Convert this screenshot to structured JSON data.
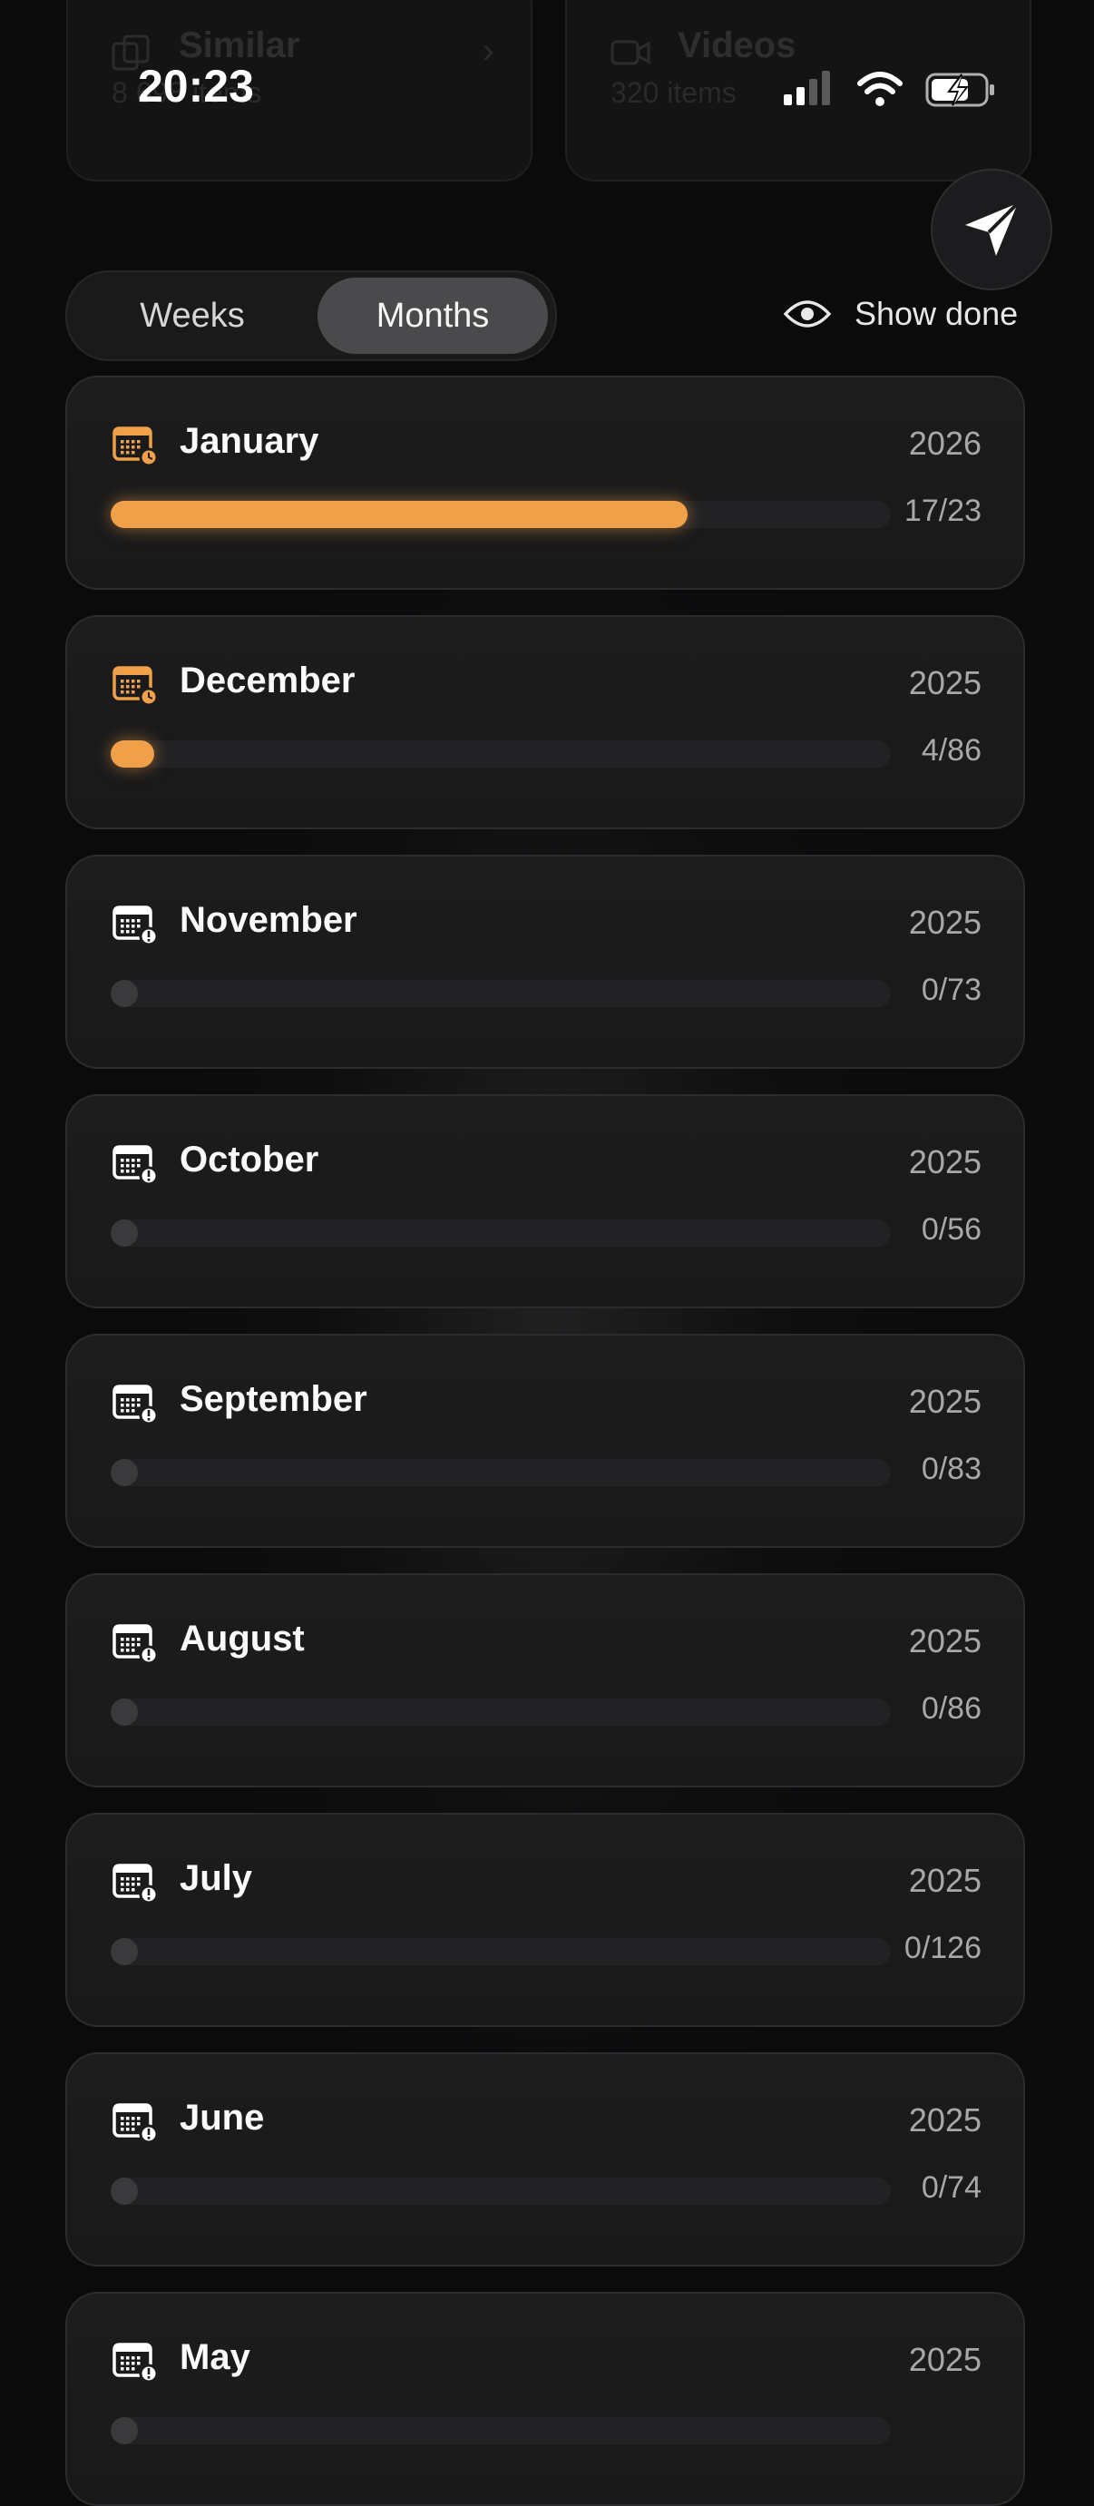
{
  "status_bar": {
    "time": "20:23"
  },
  "top_cards": [
    {
      "title": "Similar",
      "subtitle": "8 698 items",
      "icon": "similar-icon"
    },
    {
      "title": "Videos",
      "subtitle": "320 items",
      "icon": "video-camera-icon"
    }
  ],
  "segmented": {
    "weeks_label": "Weeks",
    "months_label": "Months",
    "selected": "Months"
  },
  "show_done": {
    "label": "Show done",
    "icon": "eye-icon"
  },
  "months": [
    {
      "name": "January",
      "year": "2026",
      "count": "17/23",
      "done": 17,
      "total": 23,
      "icon": "calendar-clock-icon",
      "accent": "#f0a048"
    },
    {
      "name": "December",
      "year": "2025",
      "count": "4/86",
      "done": 4,
      "total": 86,
      "icon": "calendar-clock-icon",
      "accent": "#f0a048"
    },
    {
      "name": "November",
      "year": "2025",
      "count": "0/73",
      "done": 0,
      "total": 73,
      "icon": "calendar-alert-icon",
      "accent": "#ffffff"
    },
    {
      "name": "October",
      "year": "2025",
      "count": "0/56",
      "done": 0,
      "total": 56,
      "icon": "calendar-alert-icon",
      "accent": "#ffffff"
    },
    {
      "name": "September",
      "year": "2025",
      "count": "0/83",
      "done": 0,
      "total": 83,
      "icon": "calendar-alert-icon",
      "accent": "#ffffff"
    },
    {
      "name": "August",
      "year": "2025",
      "count": "0/86",
      "done": 0,
      "total": 86,
      "icon": "calendar-alert-icon",
      "accent": "#ffffff"
    },
    {
      "name": "July",
      "year": "2025",
      "count": "0/126",
      "done": 0,
      "total": 126,
      "icon": "calendar-alert-icon",
      "accent": "#ffffff"
    },
    {
      "name": "June",
      "year": "2025",
      "count": "0/74",
      "done": 0,
      "total": 74,
      "icon": "calendar-alert-icon",
      "accent": "#ffffff"
    },
    {
      "name": "May",
      "year": "2025",
      "count": "",
      "done": 0,
      "total": 0,
      "icon": "calendar-alert-icon",
      "accent": "#ffffff"
    }
  ],
  "colors": {
    "accent": "#f0a048",
    "background": "#0b0b0c"
  }
}
